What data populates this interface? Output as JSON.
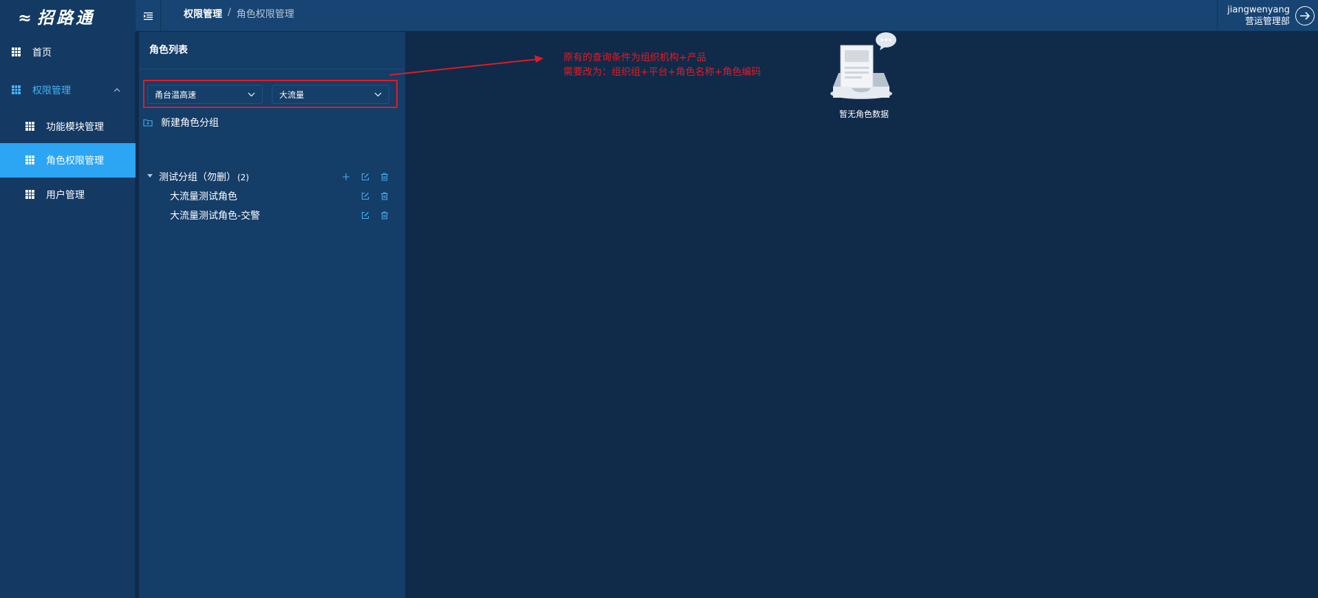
{
  "app": {
    "logo_text": "招路通"
  },
  "header": {
    "breadcrumb": [
      "权限管理",
      "/",
      "角色权限管理"
    ],
    "user_name": "jiangwenyang",
    "user_dept": "营运管理部"
  },
  "sidebar": {
    "items": [
      {
        "label": "首页"
      },
      {
        "label": "权限管理"
      },
      {
        "label": "功能模块管理"
      },
      {
        "label": "角色权限管理"
      },
      {
        "label": "用户管理"
      }
    ]
  },
  "panel": {
    "title": "角色列表",
    "filter1": "甬台温高速",
    "filter2": "大流量",
    "new_group": "新建角色分组",
    "group_name": "测试分组（勿删）",
    "group_count": "(2)",
    "roles": [
      "大流量测试角色",
      "大流量测试角色-交警"
    ]
  },
  "annotation": {
    "line1": "原有的查询条件为组织机构+产品",
    "line2": "需要改为：组织组+平台+角色名称+角色编码"
  },
  "empty_state": {
    "text": "暂无角色数据"
  },
  "colors": {
    "accent": "#2ca6f3",
    "annotation_red": "#e41b23",
    "background": "#102a4a"
  }
}
